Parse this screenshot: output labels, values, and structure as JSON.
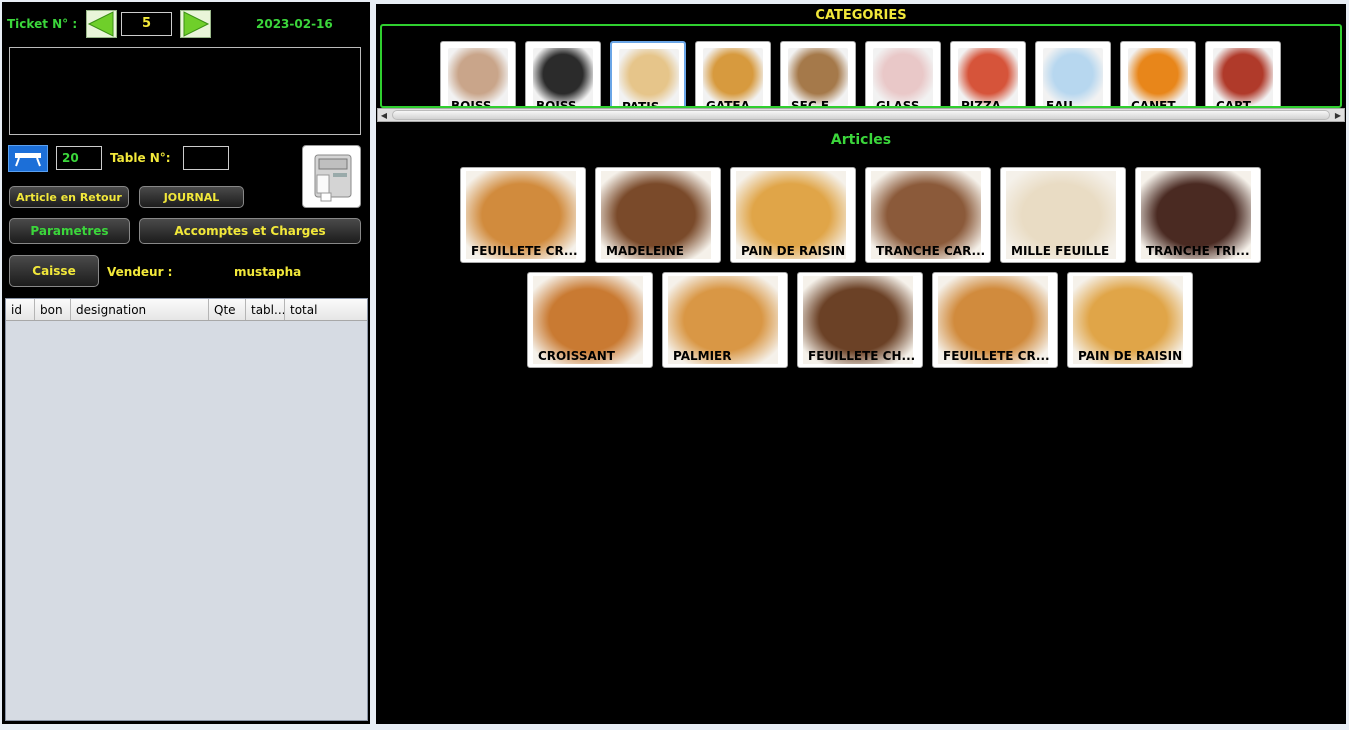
{
  "header": {
    "ticket_label": "Ticket N° :",
    "ticket_number": "5",
    "date": "2023-02-16"
  },
  "table": {
    "count": "20",
    "table_no_label": "Table N°:",
    "table_no_value": ""
  },
  "buttons": {
    "article_retour": "Article en Retour",
    "journal": "JOURNAL",
    "parametres": "Parametres",
    "accomptes": "Accomptes et Charges",
    "caisse": "Caisse"
  },
  "vendeur": {
    "label": "Vendeur :",
    "name": "mustapha"
  },
  "grid": {
    "columns": [
      "id",
      "bon",
      "designation",
      "Qte",
      "tabl...",
      "total"
    ]
  },
  "categories": {
    "title": "CATEGORIES",
    "items": [
      {
        "name": "BOISS...",
        "icon": "soda-bottles-image",
        "color": "#c9a58a"
      },
      {
        "name": "BOISS...",
        "icon": "coffee-cup-image",
        "color": "#2b2b2b"
      },
      {
        "name": "PATIS...",
        "icon": "cake-image",
        "color": "#e6c58a"
      },
      {
        "name": "GATEA...",
        "icon": "pie-image",
        "color": "#d79a3e"
      },
      {
        "name": "SEC F...",
        "icon": "dry-fruits-image",
        "color": "#a5794a"
      },
      {
        "name": "GLASS...",
        "icon": "ice-cream-image",
        "color": "#e9c8c8"
      },
      {
        "name": "PIZZA",
        "icon": "pizza-image",
        "color": "#d6543a"
      },
      {
        "name": "EAU",
        "icon": "water-bottle-image",
        "color": "#b7d7ef"
      },
      {
        "name": "CANET...",
        "icon": "fanta-can-image",
        "color": "#e8861a"
      },
      {
        "name": "CART...",
        "icon": "juice-carton-image",
        "color": "#b03a2a"
      }
    ]
  },
  "articles": {
    "title": "Articles",
    "items": [
      {
        "name": "FEUILLETE CR...",
        "icon": "twisted-pastry-image",
        "color": "#d18b3d"
      },
      {
        "name": "MADELEINE",
        "icon": "muffin-image",
        "color": "#7a4a2a"
      },
      {
        "name": "PAIN DE RAISIN",
        "icon": "raisin-bread-image",
        "color": "#e0a548"
      },
      {
        "name": "TRANCHE CAR...",
        "icon": "cake-slice-image",
        "color": "#8b5a3a"
      },
      {
        "name": "MILLE FEUILLE",
        "icon": "mille-feuille-image",
        "color": "#e9dcc4"
      },
      {
        "name": "TRANCHE TRI...",
        "icon": "chocolate-slice-image",
        "color": "#4a2a22"
      },
      {
        "name": "CROISSANT",
        "icon": "croissant-image",
        "color": "#c97a32"
      },
      {
        "name": "PALMIER",
        "icon": "palmier-image",
        "color": "#d99745"
      },
      {
        "name": "FEUILLETE CH...",
        "icon": "choc-twists-image",
        "color": "#6b4126"
      },
      {
        "name": "FEUILLETE CR...",
        "icon": "twisted-pastry-image",
        "color": "#d18b3d"
      },
      {
        "name": "PAIN DE RAISIN",
        "icon": "raisin-bread-image",
        "color": "#e0a548"
      }
    ]
  }
}
